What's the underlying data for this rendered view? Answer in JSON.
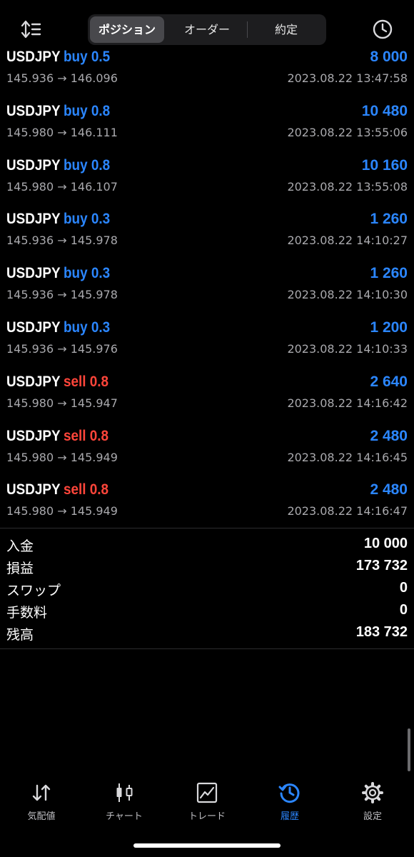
{
  "header": {
    "sort_icon": "sort-arrows-icon",
    "clock_icon": "clock-icon",
    "tabs": [
      {
        "label": "ポジション",
        "active": true
      },
      {
        "label": "オーダー",
        "active": false
      },
      {
        "label": "約定",
        "active": false
      }
    ]
  },
  "trades": [
    {
      "symbol": "USDJPY",
      "side": "buy 0.5",
      "side_type": "buy",
      "profit": "8 000",
      "prices": "145.936 → 146.096",
      "time": "2023.08.22 13:47:58"
    },
    {
      "symbol": "USDJPY",
      "side": "buy 0.8",
      "side_type": "buy",
      "profit": "10 480",
      "prices": "145.980 → 146.111",
      "time": "2023.08.22 13:55:06"
    },
    {
      "symbol": "USDJPY",
      "side": "buy 0.8",
      "side_type": "buy",
      "profit": "10 160",
      "prices": "145.980 → 146.107",
      "time": "2023.08.22 13:55:08"
    },
    {
      "symbol": "USDJPY",
      "side": "buy 0.3",
      "side_type": "buy",
      "profit": "1 260",
      "prices": "145.936 → 145.978",
      "time": "2023.08.22 14:10:27"
    },
    {
      "symbol": "USDJPY",
      "side": "buy 0.3",
      "side_type": "buy",
      "profit": "1 260",
      "prices": "145.936 → 145.978",
      "time": "2023.08.22 14:10:30"
    },
    {
      "symbol": "USDJPY",
      "side": "buy 0.3",
      "side_type": "buy",
      "profit": "1 200",
      "prices": "145.936 → 145.976",
      "time": "2023.08.22 14:10:33"
    },
    {
      "symbol": "USDJPY",
      "side": "sell 0.8",
      "side_type": "sell",
      "profit": "2 640",
      "prices": "145.980 → 145.947",
      "time": "2023.08.22 14:16:42"
    },
    {
      "symbol": "USDJPY",
      "side": "sell 0.8",
      "side_type": "sell",
      "profit": "2 480",
      "prices": "145.980 → 145.949",
      "time": "2023.08.22 14:16:45"
    },
    {
      "symbol": "USDJPY",
      "side": "sell 0.8",
      "side_type": "sell",
      "profit": "2 480",
      "prices": "145.980 → 145.949",
      "time": "2023.08.22 14:16:47"
    }
  ],
  "summary": [
    {
      "label": "入金",
      "value": "10 000"
    },
    {
      "label": "損益",
      "value": "173 732"
    },
    {
      "label": "スワップ",
      "value": "0"
    },
    {
      "label": "手数料",
      "value": "0"
    },
    {
      "label": "残高",
      "value": "183 732"
    }
  ],
  "tabbar": [
    {
      "label": "気配値",
      "icon": "quotes-arrows-icon",
      "active": false
    },
    {
      "label": "チャート",
      "icon": "candlestick-chart-icon",
      "active": false
    },
    {
      "label": "トレード",
      "icon": "trade-chart-icon",
      "active": false
    },
    {
      "label": "履歴",
      "icon": "history-clock-icon",
      "active": true
    },
    {
      "label": "設定",
      "icon": "gear-icon",
      "active": false
    }
  ],
  "colors": {
    "background": "#000000",
    "buy": "#2b86ff",
    "sell": "#ff453a",
    "profit": "#2b86ff",
    "active_tab": "#2b86ff",
    "secondary_text": "#a9a9ad"
  }
}
